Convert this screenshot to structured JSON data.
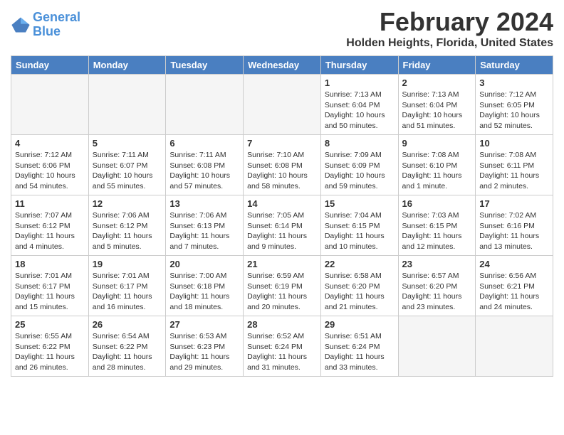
{
  "header": {
    "logo_line1": "General",
    "logo_line2": "Blue",
    "month": "February 2024",
    "location": "Holden Heights, Florida, United States"
  },
  "weekdays": [
    "Sunday",
    "Monday",
    "Tuesday",
    "Wednesday",
    "Thursday",
    "Friday",
    "Saturday"
  ],
  "weeks": [
    [
      {
        "day": "",
        "info": "",
        "empty": true
      },
      {
        "day": "",
        "info": "",
        "empty": true
      },
      {
        "day": "",
        "info": "",
        "empty": true
      },
      {
        "day": "",
        "info": "",
        "empty": true
      },
      {
        "day": "1",
        "info": "Sunrise: 7:13 AM\nSunset: 6:04 PM\nDaylight: 10 hours\nand 50 minutes.",
        "empty": false
      },
      {
        "day": "2",
        "info": "Sunrise: 7:13 AM\nSunset: 6:04 PM\nDaylight: 10 hours\nand 51 minutes.",
        "empty": false
      },
      {
        "day": "3",
        "info": "Sunrise: 7:12 AM\nSunset: 6:05 PM\nDaylight: 10 hours\nand 52 minutes.",
        "empty": false
      }
    ],
    [
      {
        "day": "4",
        "info": "Sunrise: 7:12 AM\nSunset: 6:06 PM\nDaylight: 10 hours\nand 54 minutes.",
        "empty": false
      },
      {
        "day": "5",
        "info": "Sunrise: 7:11 AM\nSunset: 6:07 PM\nDaylight: 10 hours\nand 55 minutes.",
        "empty": false
      },
      {
        "day": "6",
        "info": "Sunrise: 7:11 AM\nSunset: 6:08 PM\nDaylight: 10 hours\nand 57 minutes.",
        "empty": false
      },
      {
        "day": "7",
        "info": "Sunrise: 7:10 AM\nSunset: 6:08 PM\nDaylight: 10 hours\nand 58 minutes.",
        "empty": false
      },
      {
        "day": "8",
        "info": "Sunrise: 7:09 AM\nSunset: 6:09 PM\nDaylight: 10 hours\nand 59 minutes.",
        "empty": false
      },
      {
        "day": "9",
        "info": "Sunrise: 7:08 AM\nSunset: 6:10 PM\nDaylight: 11 hours\nand 1 minute.",
        "empty": false
      },
      {
        "day": "10",
        "info": "Sunrise: 7:08 AM\nSunset: 6:11 PM\nDaylight: 11 hours\nand 2 minutes.",
        "empty": false
      }
    ],
    [
      {
        "day": "11",
        "info": "Sunrise: 7:07 AM\nSunset: 6:12 PM\nDaylight: 11 hours\nand 4 minutes.",
        "empty": false
      },
      {
        "day": "12",
        "info": "Sunrise: 7:06 AM\nSunset: 6:12 PM\nDaylight: 11 hours\nand 5 minutes.",
        "empty": false
      },
      {
        "day": "13",
        "info": "Sunrise: 7:06 AM\nSunset: 6:13 PM\nDaylight: 11 hours\nand 7 minutes.",
        "empty": false
      },
      {
        "day": "14",
        "info": "Sunrise: 7:05 AM\nSunset: 6:14 PM\nDaylight: 11 hours\nand 9 minutes.",
        "empty": false
      },
      {
        "day": "15",
        "info": "Sunrise: 7:04 AM\nSunset: 6:15 PM\nDaylight: 11 hours\nand 10 minutes.",
        "empty": false
      },
      {
        "day": "16",
        "info": "Sunrise: 7:03 AM\nSunset: 6:15 PM\nDaylight: 11 hours\nand 12 minutes.",
        "empty": false
      },
      {
        "day": "17",
        "info": "Sunrise: 7:02 AM\nSunset: 6:16 PM\nDaylight: 11 hours\nand 13 minutes.",
        "empty": false
      }
    ],
    [
      {
        "day": "18",
        "info": "Sunrise: 7:01 AM\nSunset: 6:17 PM\nDaylight: 11 hours\nand 15 minutes.",
        "empty": false
      },
      {
        "day": "19",
        "info": "Sunrise: 7:01 AM\nSunset: 6:17 PM\nDaylight: 11 hours\nand 16 minutes.",
        "empty": false
      },
      {
        "day": "20",
        "info": "Sunrise: 7:00 AM\nSunset: 6:18 PM\nDaylight: 11 hours\nand 18 minutes.",
        "empty": false
      },
      {
        "day": "21",
        "info": "Sunrise: 6:59 AM\nSunset: 6:19 PM\nDaylight: 11 hours\nand 20 minutes.",
        "empty": false
      },
      {
        "day": "22",
        "info": "Sunrise: 6:58 AM\nSunset: 6:20 PM\nDaylight: 11 hours\nand 21 minutes.",
        "empty": false
      },
      {
        "day": "23",
        "info": "Sunrise: 6:57 AM\nSunset: 6:20 PM\nDaylight: 11 hours\nand 23 minutes.",
        "empty": false
      },
      {
        "day": "24",
        "info": "Sunrise: 6:56 AM\nSunset: 6:21 PM\nDaylight: 11 hours\nand 24 minutes.",
        "empty": false
      }
    ],
    [
      {
        "day": "25",
        "info": "Sunrise: 6:55 AM\nSunset: 6:22 PM\nDaylight: 11 hours\nand 26 minutes.",
        "empty": false
      },
      {
        "day": "26",
        "info": "Sunrise: 6:54 AM\nSunset: 6:22 PM\nDaylight: 11 hours\nand 28 minutes.",
        "empty": false
      },
      {
        "day": "27",
        "info": "Sunrise: 6:53 AM\nSunset: 6:23 PM\nDaylight: 11 hours\nand 29 minutes.",
        "empty": false
      },
      {
        "day": "28",
        "info": "Sunrise: 6:52 AM\nSunset: 6:24 PM\nDaylight: 11 hours\nand 31 minutes.",
        "empty": false
      },
      {
        "day": "29",
        "info": "Sunrise: 6:51 AM\nSunset: 6:24 PM\nDaylight: 11 hours\nand 33 minutes.",
        "empty": false
      },
      {
        "day": "",
        "info": "",
        "empty": true
      },
      {
        "day": "",
        "info": "",
        "empty": true
      }
    ]
  ]
}
